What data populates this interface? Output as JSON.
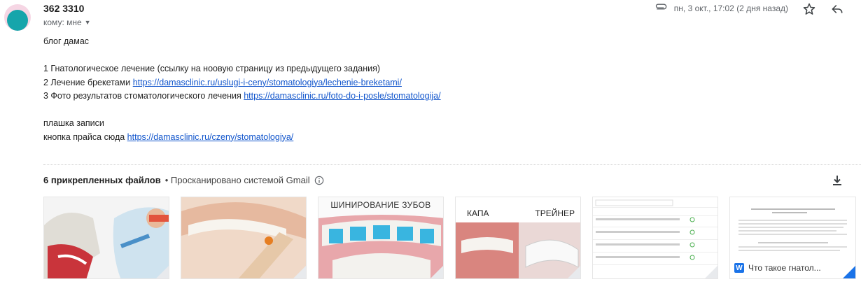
{
  "email": {
    "sender": "362 3310",
    "to_label": "кому: мне",
    "date": "пн, 3 окт., 17:02 (2 дня назад)"
  },
  "body": {
    "lines": [
      {
        "text": "блог дамас",
        "link": ""
      },
      {
        "text": "",
        "link": ""
      },
      {
        "text": "1 Гнатологическое лечение (ссылку на ноовую страницу из предыдущего задания)",
        "link": ""
      },
      {
        "text": "2 Лечение брекетами  ",
        "link": "https://damasclinic.ru/uslugi-i-ceny/stomatologiya/lechenie-breketami/"
      },
      {
        "text": "3 Фото результатов стоматологического лечения ",
        "link": "https://damasclinic.ru/foto-do-i-posle/stomatologija/"
      },
      {
        "text": "",
        "link": ""
      },
      {
        "text": "плашка записи",
        "link": ""
      },
      {
        "text": "кнопка прайса сюда ",
        "link": "https://damasclinic.ru/czeny/stomatologiya/"
      }
    ]
  },
  "attachments": {
    "count_label": "6 прикрепленных файлов",
    "scan_label": "• Просканировано системой Gmail",
    "thumb3_title": "ШИНИРОВАНИЕ  ЗУБОВ",
    "thumb4_left": "КАПА",
    "thumb4_right": "ТРЕЙНЕР",
    "thumb6_name": "Что такое гнатол..."
  },
  "colors": {
    "link": "#1155cc",
    "avatar_bg": "#16a5ab",
    "word_icon": "#1a73e8"
  },
  "icons": [
    "paperclip-icon",
    "star-icon",
    "reply-icon",
    "info-icon",
    "download-icon",
    "word-icon"
  ]
}
